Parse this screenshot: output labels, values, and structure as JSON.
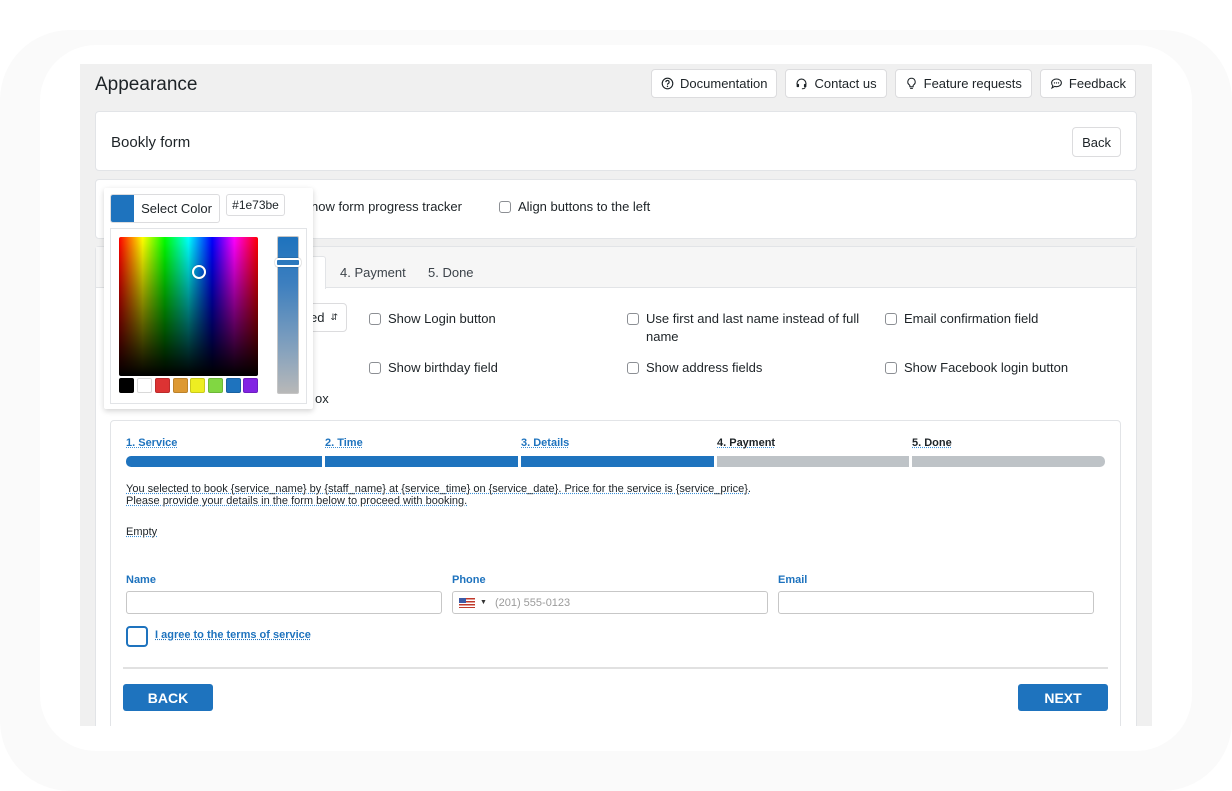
{
  "header": {
    "title": "Appearance",
    "buttons": [
      {
        "label": "Documentation",
        "icon": "question-circle-icon"
      },
      {
        "label": "Contact us",
        "icon": "headset-icon"
      },
      {
        "label": "Feature requests",
        "icon": "lightbulb-icon"
      },
      {
        "label": "Feedback",
        "icon": "chat-bubble-icon"
      }
    ]
  },
  "form_card": {
    "title": "Bookly form",
    "back_label": "Back"
  },
  "options_bar": {
    "progress_tracker_label": "Show form progress tracker",
    "progress_tracker_partial": "now form progress tracker",
    "align_buttons_label": "Align buttons to the left"
  },
  "color_picker": {
    "select_label": "Select Color",
    "hex_value": "#1e73be",
    "current_color": "#1e73be",
    "presets": [
      "#000000",
      "#ffffff",
      "#dd3333",
      "#dd9933",
      "#eeee22",
      "#81d742",
      "#1e73be",
      "#8224e3"
    ]
  },
  "tabs": {
    "items": [
      {
        "label": "4. Payment"
      },
      {
        "label": "5. Done"
      }
    ]
  },
  "settings": {
    "select_partial": "ed",
    "partial_text": "ox",
    "checkboxes": [
      {
        "label": "Show Login button",
        "checked": false
      },
      {
        "label": "Use first and last name instead of full name",
        "checked": false
      },
      {
        "label": "Email confirmation field",
        "checked": false
      },
      {
        "label": "Show birthday field",
        "checked": false
      },
      {
        "label": "Show address fields",
        "checked": false
      },
      {
        "label": "Show Facebook login button",
        "checked": false
      }
    ]
  },
  "preview": {
    "accent_color": "#1e73be",
    "inactive_color": "#bec3c7",
    "steps": [
      {
        "label": "1. Service",
        "done": true
      },
      {
        "label": "2. Time",
        "done": true
      },
      {
        "label": "3. Details",
        "done": true
      },
      {
        "label": "4. Payment",
        "done": false
      },
      {
        "label": "5. Done",
        "done": false
      }
    ],
    "intro_line1": "You selected to book {service_name} by {staff_name} at {service_time} on {service_date}. Price for the service is {service_price}.",
    "intro_line2": "Please provide your details in the form below to proceed with booking.",
    "empty_text": "Empty",
    "fields": {
      "name_label": "Name",
      "phone_label": "Phone",
      "phone_placeholder": "(201) 555-0123",
      "email_label": "Email"
    },
    "terms_label": "I agree to the terms of service",
    "back_button": "BACK",
    "next_button": "NEXT"
  }
}
